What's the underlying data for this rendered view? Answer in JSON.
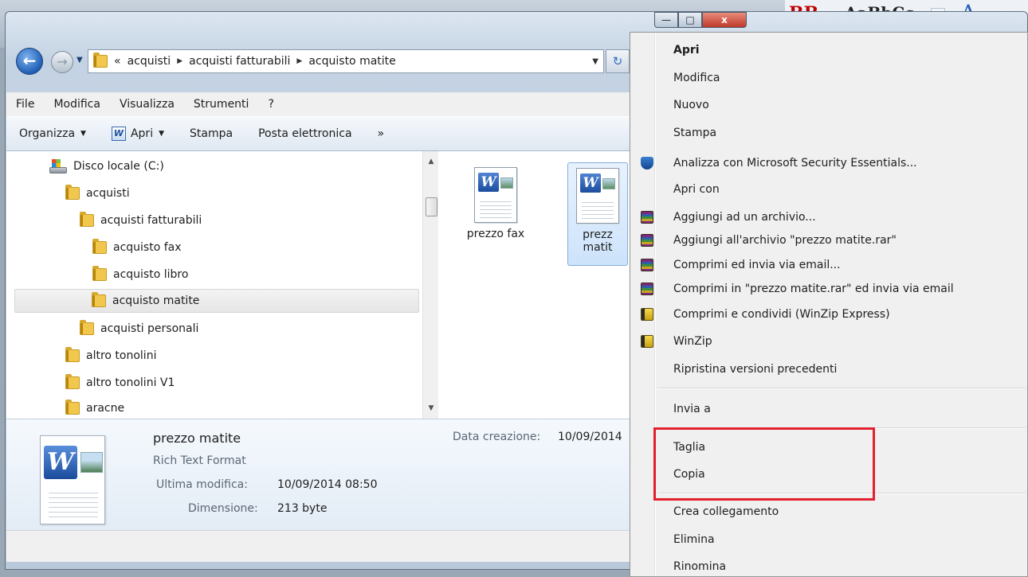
{
  "background": {
    "style_bb": "BB",
    "style_aabbcc": "AaBbCc",
    "style_a": "A"
  },
  "window": {
    "minimize": "—",
    "maximize": "□",
    "close": "x"
  },
  "address": {
    "overflow": "«",
    "crumbs": [
      "acquisti",
      "acquisti fatturabili",
      "acquisto matite"
    ]
  },
  "menubar": [
    "File",
    "Modifica",
    "Visualizza",
    "Strumenti",
    "?"
  ],
  "toolbar": {
    "organizza": "Organizza",
    "apri": "Apri",
    "stampa": "Stampa",
    "posta": "Posta elettronica",
    "more": "»"
  },
  "tree": [
    {
      "label": "Disco locale (C:)",
      "type": "drive"
    },
    {
      "label": "acquisti",
      "type": "folder"
    },
    {
      "label": "acquisti fatturabili",
      "type": "folder"
    },
    {
      "label": "acquisto fax",
      "type": "folder"
    },
    {
      "label": "acquisto libro",
      "type": "folder"
    },
    {
      "label": "acquisto matite",
      "type": "folder",
      "selected": true
    },
    {
      "label": "acquisti personali",
      "type": "folder"
    },
    {
      "label": "altro tonolini",
      "type": "folder"
    },
    {
      "label": "altro tonolini V1",
      "type": "folder"
    },
    {
      "label": "aracne",
      "type": "folder"
    }
  ],
  "files": [
    {
      "line1": "prezzo fax",
      "line2": ""
    },
    {
      "line1": "prezz",
      "line2": "matit",
      "selected": true
    }
  ],
  "details": {
    "name": "prezzo matite",
    "type": "Rich Text Format",
    "modified_label": "Ultima modifica:",
    "modified_value": "10/09/2014 08:50",
    "size_label": "Dimensione:",
    "size_value": "213 byte",
    "created_label": "Data creazione:",
    "created_value": "10/09/2014"
  },
  "context_menu": {
    "items": [
      {
        "label": "Apri",
        "bold": true
      },
      {
        "label": "Modifica"
      },
      {
        "label": "Nuovo"
      },
      {
        "label": "Stampa"
      },
      {
        "label": "Analizza con Microsoft Security Essentials...",
        "icon": "security-essentials-icon"
      },
      {
        "label": "Apri con"
      },
      {
        "label": "Aggiungi ad un archivio...",
        "icon": "winrar-icon"
      },
      {
        "label": "Aggiungi all'archivio \"prezzo matite.rar\"",
        "icon": "winrar-icon"
      },
      {
        "label": "Comprimi ed invia via email...",
        "icon": "winrar-icon"
      },
      {
        "label": "Comprimi in \"prezzo matite.rar\" ed invia via email",
        "icon": "winrar-icon"
      },
      {
        "label": "Comprimi e condividi (WinZip Express)",
        "icon": "winzip-icon"
      },
      {
        "label": "WinZip",
        "icon": "winzip-icon"
      },
      {
        "label": "Ripristina versioni precedenti"
      },
      {
        "label": "Invia a",
        "separator_before": true
      },
      {
        "label": "Taglia",
        "separator_before": true
      },
      {
        "label": "Copia"
      },
      {
        "label": "Crea collegamento",
        "separator_before": true
      },
      {
        "label": "Elimina"
      },
      {
        "label": "Rinomina"
      }
    ]
  },
  "colors": {
    "highlight_box": "#e3202e",
    "selection": "#cde3fb",
    "menu_bg": "#f0f0f0"
  }
}
